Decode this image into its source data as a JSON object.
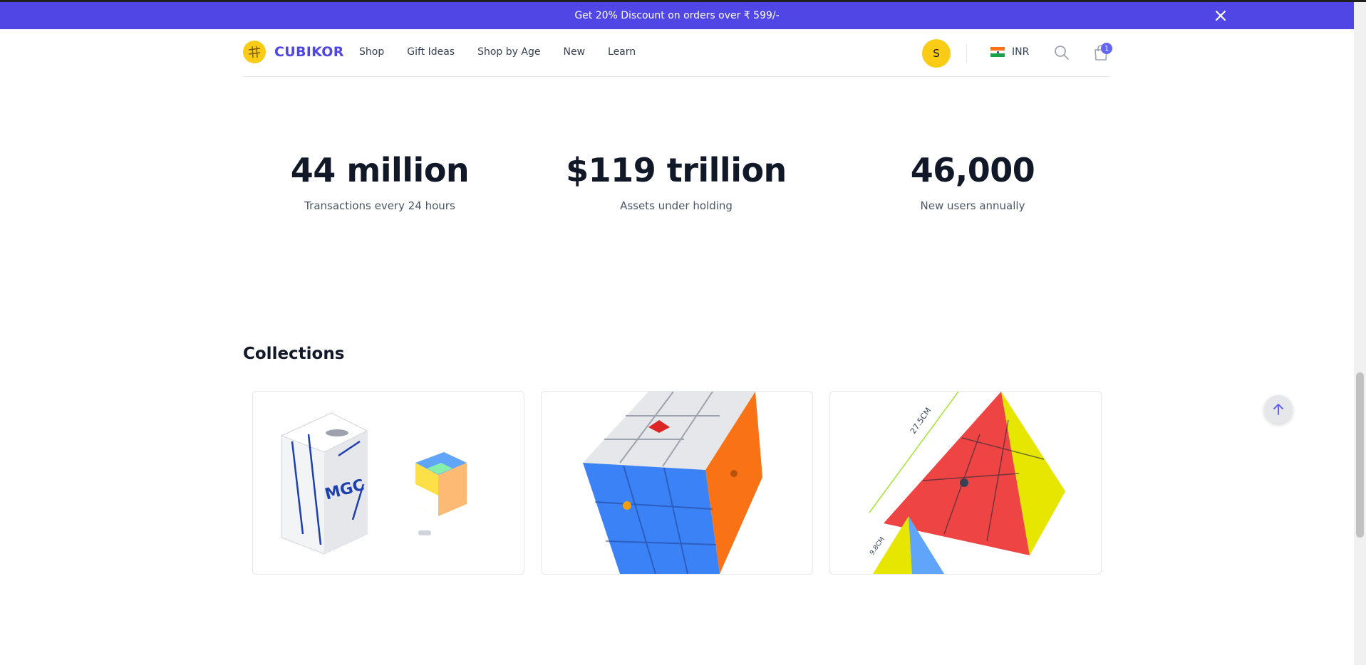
{
  "banner": {
    "text": "Get 20% Discount on orders over ₹ 599/-"
  },
  "header": {
    "brand": "CUBIKOR",
    "nav": [
      "Shop",
      "Gift Ideas",
      "Shop by Age",
      "New",
      "Learn"
    ],
    "avatar_initial": "S",
    "currency": "INR",
    "cart_count": "1"
  },
  "stats": [
    {
      "value": "44 million",
      "label": "Transactions every 24 hours"
    },
    {
      "value": "$119 trillion",
      "label": "Assets under holding"
    },
    {
      "value": "46,000",
      "label": "New users annually"
    }
  ],
  "collections": {
    "title": "Collections",
    "cards": [
      {
        "icon": "mgc-2x2-cube-with-box"
      },
      {
        "icon": "3x3-speed-cube"
      },
      {
        "icon": "pyraminx-puzzle"
      }
    ]
  },
  "colors": {
    "accent": "#4f46e5",
    "brand_yellow": "#facc15",
    "text": "#111827"
  }
}
